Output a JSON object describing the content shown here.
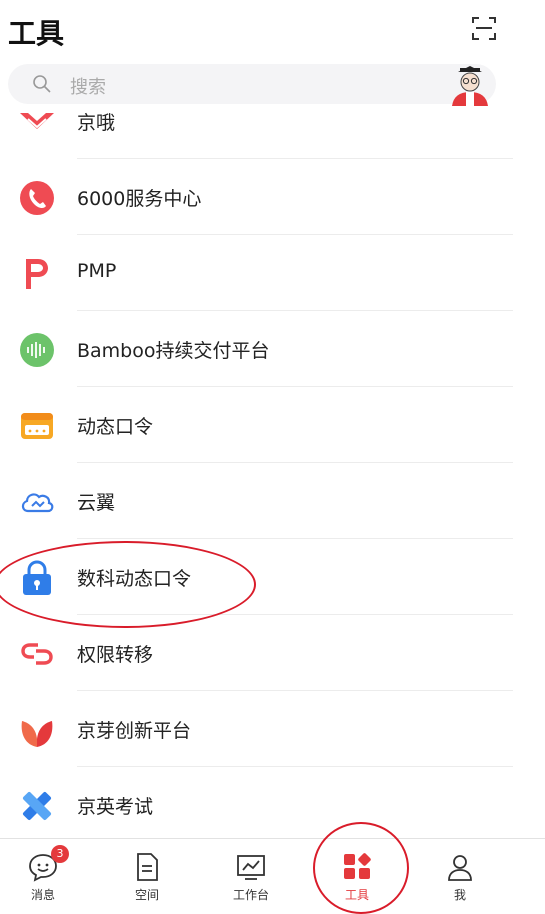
{
  "header": {
    "title": "工具"
  },
  "search": {
    "placeholder": "搜索"
  },
  "tools": [
    {
      "label": "京哦",
      "icon": "jingo-icon"
    },
    {
      "label": "6000服务中心",
      "icon": "phone-icon"
    },
    {
      "label": "PMP",
      "icon": "pmp-icon"
    },
    {
      "label": "Bamboo持续交付平台",
      "icon": "bamboo-icon"
    },
    {
      "label": "动态口令",
      "icon": "token-icon"
    },
    {
      "label": "云翼",
      "icon": "cloud-icon"
    },
    {
      "label": "数科动态口令",
      "icon": "lock-icon"
    },
    {
      "label": "权限转移",
      "icon": "link-icon"
    },
    {
      "label": "京芽创新平台",
      "icon": "sprout-icon"
    },
    {
      "label": "京英考试",
      "icon": "exam-icon"
    }
  ],
  "tabbar": {
    "items": [
      {
        "label": "消息",
        "badge": "3",
        "icon": "message-icon"
      },
      {
        "label": "空间",
        "icon": "space-icon"
      },
      {
        "label": "工作台",
        "icon": "workbench-icon"
      },
      {
        "label": "工具",
        "icon": "tools-icon",
        "active": true
      },
      {
        "label": "我",
        "icon": "profile-icon"
      }
    ]
  },
  "colors": {
    "accent": "#e4393c",
    "annotation": "#d91c2a"
  }
}
